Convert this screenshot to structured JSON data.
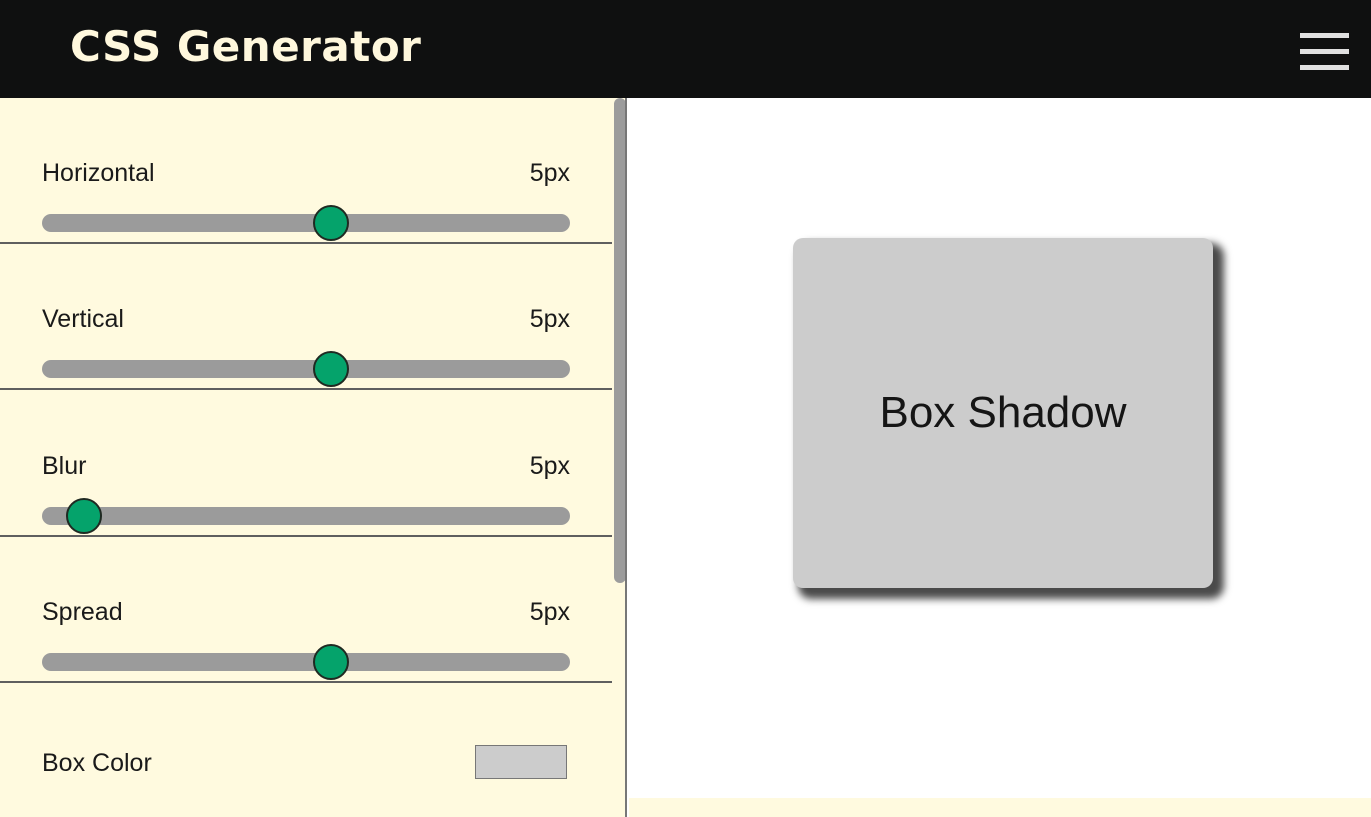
{
  "header": {
    "title": "CSS Generator",
    "menu_icon": "hamburger-menu-icon"
  },
  "controls": [
    {
      "label": "Horizontal",
      "value": "5px",
      "slider_fraction": 0.547
    },
    {
      "label": "Vertical",
      "value": "5px",
      "slider_fraction": 0.547
    },
    {
      "label": "Blur",
      "value": "5px",
      "slider_fraction": 0.08
    },
    {
      "label": "Spread",
      "value": "5px",
      "slider_fraction": 0.547
    }
  ],
  "box_color": {
    "label": "Box Color",
    "value": "#cccccc"
  },
  "preview": {
    "text": "Box Shadow",
    "box_color": "#cccccc",
    "shadow_color": "#4a4a4a"
  },
  "colors": {
    "header_bg": "#0f1010",
    "logo_text": "#fff8dd",
    "panel_bg": "#fffadf",
    "slider_thumb": "#05a36b",
    "slider_track": "#9b9b9b"
  }
}
